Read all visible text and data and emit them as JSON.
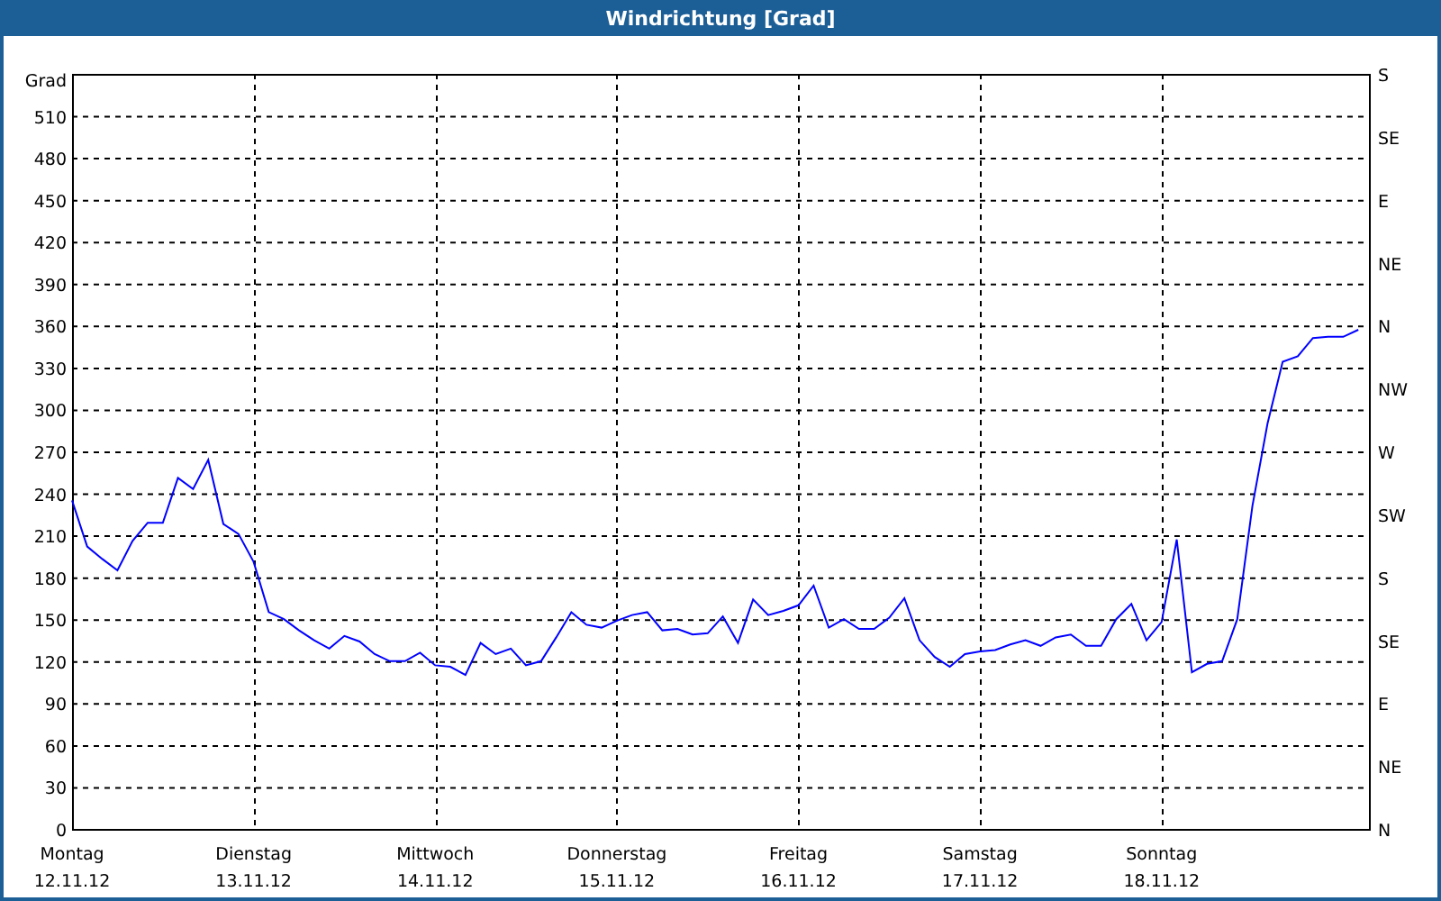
{
  "window": {
    "title": "Windrichtung [Grad]"
  },
  "chart": {
    "chart_data": {
      "type": "line",
      "ylabel": "Grad",
      "ylim": [
        0,
        540
      ],
      "yticks": [
        0,
        30,
        60,
        90,
        120,
        150,
        180,
        210,
        240,
        270,
        300,
        330,
        360,
        390,
        420,
        450,
        480,
        510
      ],
      "grid": true,
      "annotations": [
        "N",
        "NE",
        "E",
        "SE",
        "S",
        "SW",
        "W",
        "NW",
        "N",
        "NE",
        "E",
        "SE",
        "S"
      ],
      "categories": [
        "Montag\n12.11.12",
        null,
        null,
        null,
        null,
        null,
        null,
        null,
        null,
        null,
        null,
        null,
        "Dienstag\n13.11.12",
        null,
        null,
        null,
        null,
        null,
        null,
        null,
        null,
        null,
        null,
        null,
        "Mittwoch\n14.11.12",
        null,
        null,
        null,
        null,
        null,
        null,
        null,
        null,
        null,
        null,
        null,
        "Donnerstag\n15.11.12",
        null,
        null,
        null,
        null,
        null,
        null,
        null,
        null,
        null,
        null,
        null,
        "Freitag\n16.11.12",
        null,
        null,
        null,
        null,
        null,
        null,
        null,
        null,
        null,
        null,
        null,
        "Samstag\n17.11.12",
        null,
        null,
        null,
        null,
        null,
        null,
        null,
        null,
        null,
        null,
        null,
        "Sonntag\n18.11.12",
        null,
        null,
        null,
        null,
        null,
        null,
        null,
        null,
        null,
        null,
        null,
        null,
        null
      ],
      "series": [
        {
          "color": "#0000ff",
          "values": [
            235,
            202,
            193,
            185,
            206,
            219,
            219,
            251,
            243,
            264,
            218,
            211,
            191,
            155,
            150,
            142,
            135,
            129,
            138,
            134,
            125,
            120,
            120,
            126,
            117,
            116,
            110,
            133,
            125,
            129,
            117,
            120,
            137,
            155,
            146,
            144,
            149,
            153,
            155,
            142,
            143,
            139,
            140,
            152,
            133,
            164,
            153,
            156,
            160,
            174,
            144,
            150,
            143,
            143,
            151,
            165,
            135,
            123,
            116,
            125,
            127,
            128,
            132,
            135,
            131,
            137,
            139,
            131,
            131,
            150,
            161,
            135,
            148,
            207,
            112,
            118,
            120,
            150,
            231,
            290,
            334,
            338,
            351,
            352,
            352,
            357
          ]
        }
      ]
    }
  }
}
